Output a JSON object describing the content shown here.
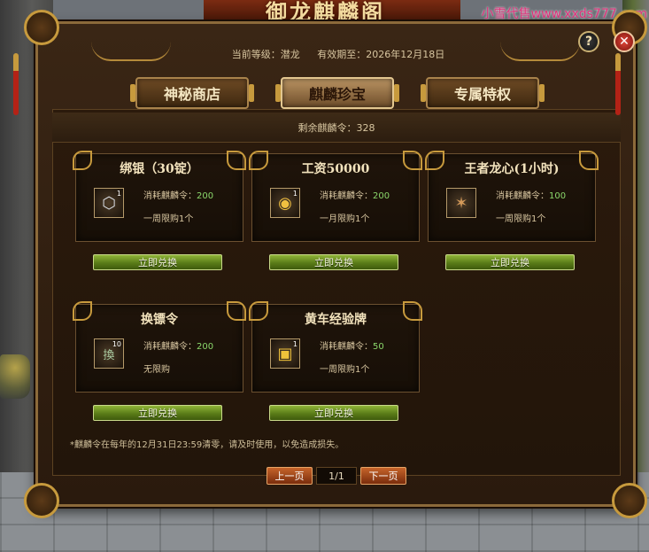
{
  "window": {
    "title": "御龙麒麟阁",
    "watermark": "小雪代售www.xxds777.com",
    "help_glyph": "?",
    "close_glyph": "✕"
  },
  "header": {
    "level_label": "当前等级：潜龙",
    "expire_label": "有效期至：2026年12月18日"
  },
  "tabs": [
    {
      "label": "神秘商店",
      "active": false
    },
    {
      "label": "麒麟珍宝",
      "active": true
    },
    {
      "label": "专属特权",
      "active": false
    }
  ],
  "remaining": {
    "label": "剩余麒麟令：328"
  },
  "items": [
    {
      "name": "绑银（30锭）",
      "icon": "silver-ingot-icon",
      "icon_glyph": "⬡",
      "count": "1",
      "cost_label": "消耗麒麟令：",
      "cost": "200",
      "limit": "一周限购1个",
      "button": "立即兑换"
    },
    {
      "name": "工资50000",
      "icon": "gold-coins-icon",
      "icon_glyph": "◉",
      "count": "1",
      "cost_label": "消耗麒麟令：",
      "cost": "200",
      "limit": "一月限购1个",
      "button": "立即兑换"
    },
    {
      "name": "王者龙心(1小时)",
      "icon": "dragon-heart-icon",
      "icon_glyph": "✶",
      "count": "",
      "cost_label": "消耗麒麟令：",
      "cost": "100",
      "limit": "一周限购1个",
      "button": "立即兑换"
    },
    {
      "name": "换镖令",
      "icon": "escort-token-icon",
      "icon_glyph": "換",
      "count": "10",
      "cost_label": "消耗麒麟令：",
      "cost": "200",
      "limit": "无限购",
      "button": "立即兑换"
    },
    {
      "name": "黄车经验牌",
      "icon": "yellow-cart-exp-icon",
      "icon_glyph": "▣",
      "count": "1",
      "cost_label": "消耗麒麟令：",
      "cost": "50",
      "limit": "一周限购1个",
      "button": "立即兑换"
    }
  ],
  "footer": {
    "note": "*麒麟令在每年的12月31日23:59清零，请及时使用，以免造成损失。",
    "prev": "上一页",
    "page": "1/1",
    "next": "下一页"
  }
}
